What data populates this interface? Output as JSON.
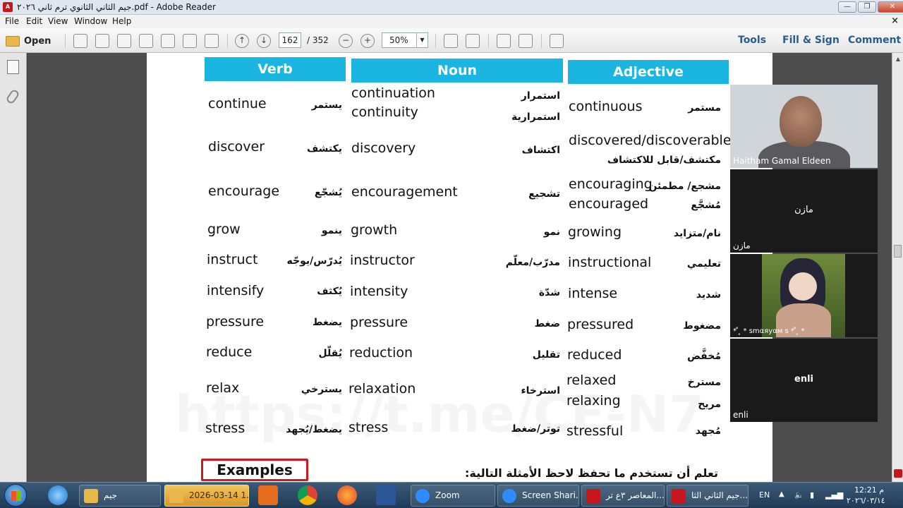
{
  "window": {
    "title": "جيم الثاني الثانوي ترم ثاني ٢٠٢٦.pdf - Adobe Reader",
    "controls": {
      "minimize": "—",
      "maximize": "❐",
      "close": "✕"
    }
  },
  "menu": {
    "items": [
      "File",
      "Edit",
      "View",
      "Window",
      "Help"
    ],
    "close_doc": "×"
  },
  "toolbar": {
    "open_label": "Open",
    "page_current": "162",
    "page_total": "/ 352",
    "zoom_value": "50%",
    "zoom_out": "−",
    "zoom_in": "+",
    "prev_page": "↑",
    "next_page": "↓",
    "links": [
      "Tools",
      "Fill & Sign",
      "Comment"
    ]
  },
  "document": {
    "headers": {
      "verb": "Verb",
      "noun": "Noun",
      "adjective": "Adjective"
    },
    "rows": [
      {
        "verb": "continue",
        "verb_ar": "يستمر",
        "noun": [
          "continuation",
          "continuity"
        ],
        "noun_ar": [
          "استمرار",
          "استمرارية"
        ],
        "adj": [
          "continuous"
        ],
        "adj_ar": [
          "مستمر"
        ]
      },
      {
        "verb": "discover",
        "verb_ar": "يكتشف",
        "noun": [
          "discovery"
        ],
        "noun_ar": [
          "اكتشاف"
        ],
        "adj": [
          "discovered/discoverable"
        ],
        "adj_ar": [
          "مكتشف/قابل للاكتشاف"
        ]
      },
      {
        "verb": "encourage",
        "verb_ar": "يُشجّع",
        "noun": [
          "encouragement"
        ],
        "noun_ar": [
          "تشجيع"
        ],
        "adj": [
          "encouraging",
          "encouraged"
        ],
        "adj_ar": [
          "مشجع/ مطمئن",
          "مُشجَّع"
        ]
      },
      {
        "verb": "grow",
        "verb_ar": "ينمو",
        "noun": [
          "growth"
        ],
        "noun_ar": [
          "نمو"
        ],
        "adj": [
          "growing"
        ],
        "adj_ar": [
          "نام/متزايد"
        ]
      },
      {
        "verb": "instruct",
        "verb_ar": "يُدرّس/يوجّه",
        "noun": [
          "instructor"
        ],
        "noun_ar": [
          "مدرّب/معلّم"
        ],
        "adj": [
          "instructional"
        ],
        "adj_ar": [
          "تعليمي"
        ]
      },
      {
        "verb": "intensify",
        "verb_ar": "يُكثف",
        "noun": [
          "intensity"
        ],
        "noun_ar": [
          "شدّة"
        ],
        "adj": [
          "intense"
        ],
        "adj_ar": [
          "شديد"
        ]
      },
      {
        "verb": "pressure",
        "verb_ar": "يضغط",
        "noun": [
          "pressure"
        ],
        "noun_ar": [
          "ضغط"
        ],
        "adj": [
          "pressured"
        ],
        "adj_ar": [
          "مضغوط"
        ]
      },
      {
        "verb": "reduce",
        "verb_ar": "يُقلّل",
        "noun": [
          "reduction"
        ],
        "noun_ar": [
          "تقليل"
        ],
        "adj": [
          "reduced"
        ],
        "adj_ar": [
          "مُخفَّض"
        ]
      },
      {
        "verb": "relax",
        "verb_ar": "يسترخي",
        "noun": [
          "relaxation"
        ],
        "noun_ar": [
          "استرخاء"
        ],
        "adj": [
          "relaxed",
          "relaxing"
        ],
        "adj_ar": [
          "مسترخ",
          "مريح"
        ]
      },
      {
        "verb": "stress",
        "verb_ar": "يضغط/يُجهد",
        "noun": [
          "stress"
        ],
        "noun_ar": [
          "توتر/ضغط"
        ],
        "adj": [
          "stressful"
        ],
        "adj_ar": [
          "مُجهد"
        ]
      }
    ],
    "examples_label": "Examples",
    "examples_ar": "تعلم أن تستخدم ما تحفظ لاحظ الأمثلة التالية:",
    "watermark": "https://t.me/CE-N7"
  },
  "zoom_gallery": {
    "tiles": [
      {
        "name": "Haitham Gamal Eldeen",
        "center": ""
      },
      {
        "name": "مازن",
        "center": "مازن"
      },
      {
        "name": "* ̊ ̥ * ꜱmαяуαм ꜱ * ̊ ̥ *",
        "center": ""
      },
      {
        "name": "enli",
        "center": "enli"
      }
    ]
  },
  "taskbar": {
    "buttons": [
      "جيم",
      "2026-03-14 1...",
      "Zoom",
      "Screen Shari...",
      "المعاصر ٣ع تر...",
      "جيم الثاني الثا..."
    ],
    "lang": "EN",
    "time": "12:21 م",
    "date": "٢٠٢٦/٠٣/١٤"
  },
  "colors": {
    "header_blue": "#1ab6e1",
    "examples_red": "#d0191f",
    "link_blue": "#2a5d8f",
    "taskbar_active": "#e4a83b"
  }
}
